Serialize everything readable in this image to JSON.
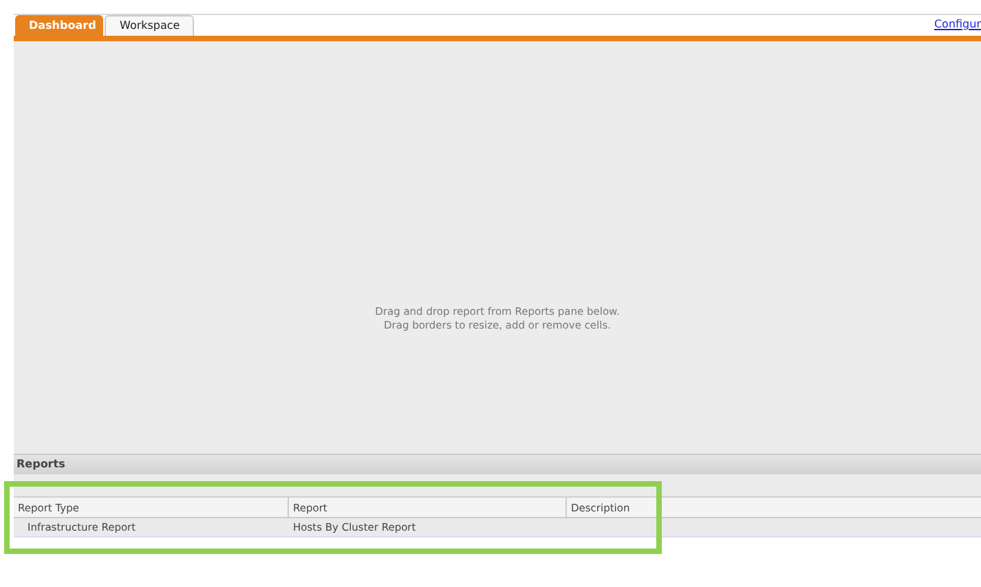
{
  "tabs": [
    {
      "label": "Dashboard",
      "selected": true
    },
    {
      "label": "Workspace",
      "selected": false
    }
  ],
  "configure_link": "Configur",
  "dashboard_message": [
    "Drag and drop report from Reports pane below.",
    "Drag borders to resize, add or remove cells."
  ],
  "reports": {
    "title": "Reports",
    "columns": [
      "Report Type",
      "Report",
      "Description"
    ],
    "rows": [
      [
        "Infrastructure Report",
        "Hosts By Cluster Report",
        ""
      ]
    ],
    "highlighted": true
  }
}
